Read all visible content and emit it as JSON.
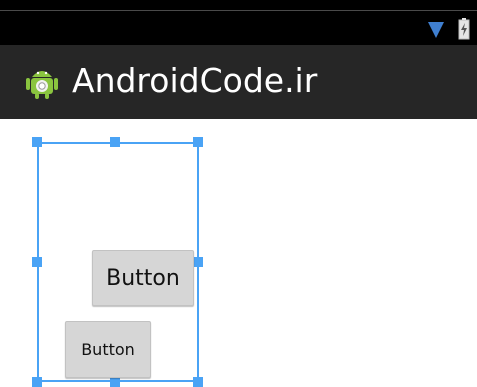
{
  "action_bar": {
    "title": "AndroidCode.ir",
    "app_icon": "android-robot-icon"
  },
  "status_bar": {
    "icons": [
      "wifi-icon",
      "battery-icon"
    ]
  },
  "buttons": {
    "button_1_label": "Button",
    "button_2_label": "Button"
  },
  "colors": {
    "status_bar": "#000000",
    "action_bar": "#262626",
    "selection": "#4aa3f5",
    "button_bg": "#d6d6d6",
    "android_green": "#8ac43f"
  }
}
